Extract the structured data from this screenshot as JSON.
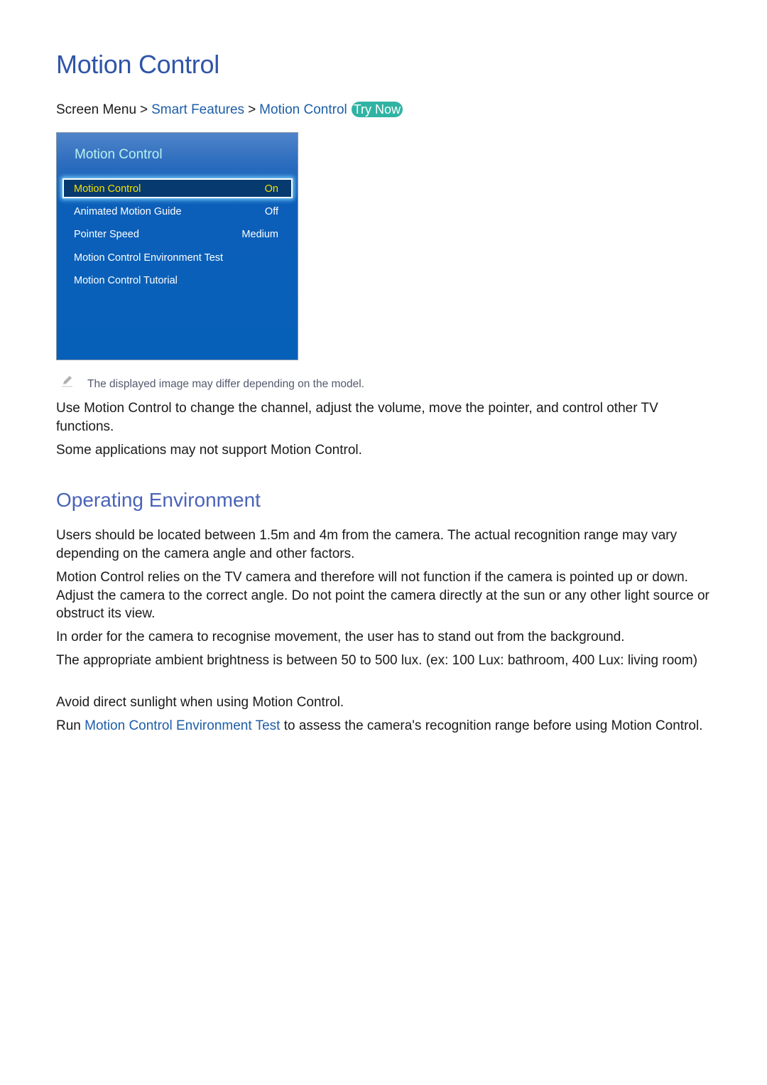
{
  "page": {
    "title": "Motion Control"
  },
  "breadcrumb": {
    "root": "Screen Menu",
    "separator": ">",
    "level1": "Smart Features",
    "level2": "Motion Control",
    "try_now": "Try Now"
  },
  "tv_menu": {
    "title": "Motion Control",
    "items": [
      {
        "label": "Motion Control",
        "value": "On",
        "selected": true
      },
      {
        "label": "Animated Motion Guide",
        "value": "Off"
      },
      {
        "label": "Pointer Speed",
        "value": "Medium"
      },
      {
        "label": "Motion Control Environment Test",
        "value": ""
      },
      {
        "label": "Motion Control Tutorial",
        "value": ""
      }
    ]
  },
  "note": {
    "icon": "pencil-icon",
    "text": "The displayed image may differ depending on the model."
  },
  "intro": [
    "Use Motion Control to change the channel, adjust the volume, move the pointer, and control other TV functions.",
    "Some applications may not support Motion Control."
  ],
  "operating_environment": {
    "heading": "Operating Environment",
    "paragraphs": [
      "Users should be located between 1.5m and 4m from the camera. The actual recognition range may vary depending on the camera angle and other factors.",
      "Motion Control relies on the TV camera and therefore will not function if the camera is pointed up or down. Adjust the camera to the correct angle. Do not point the camera directly at the sun or any other light source or obstruct its view.",
      "In order for the camera to recognise movement, the user has to stand out from the background.",
      "The appropriate ambient brightness is between 50 to 500 lux. (ex: 100 Lux: bathroom, 400 Lux: living room)",
      "Avoid direct sunlight when using Motion Control."
    ],
    "last_paragraph": {
      "before": "Run ",
      "link": "Motion Control Environment Test",
      "after": " to assess the camera's recognition range before using Motion Control."
    }
  },
  "colors": {
    "title": "#2f55a8",
    "link": "#1d5ea8",
    "try_now_bg": "#2fb3a3",
    "tv_menu_bg": "#0660b8",
    "tv_selected_text": "#f4e000",
    "section_heading": "#4a63b8"
  }
}
